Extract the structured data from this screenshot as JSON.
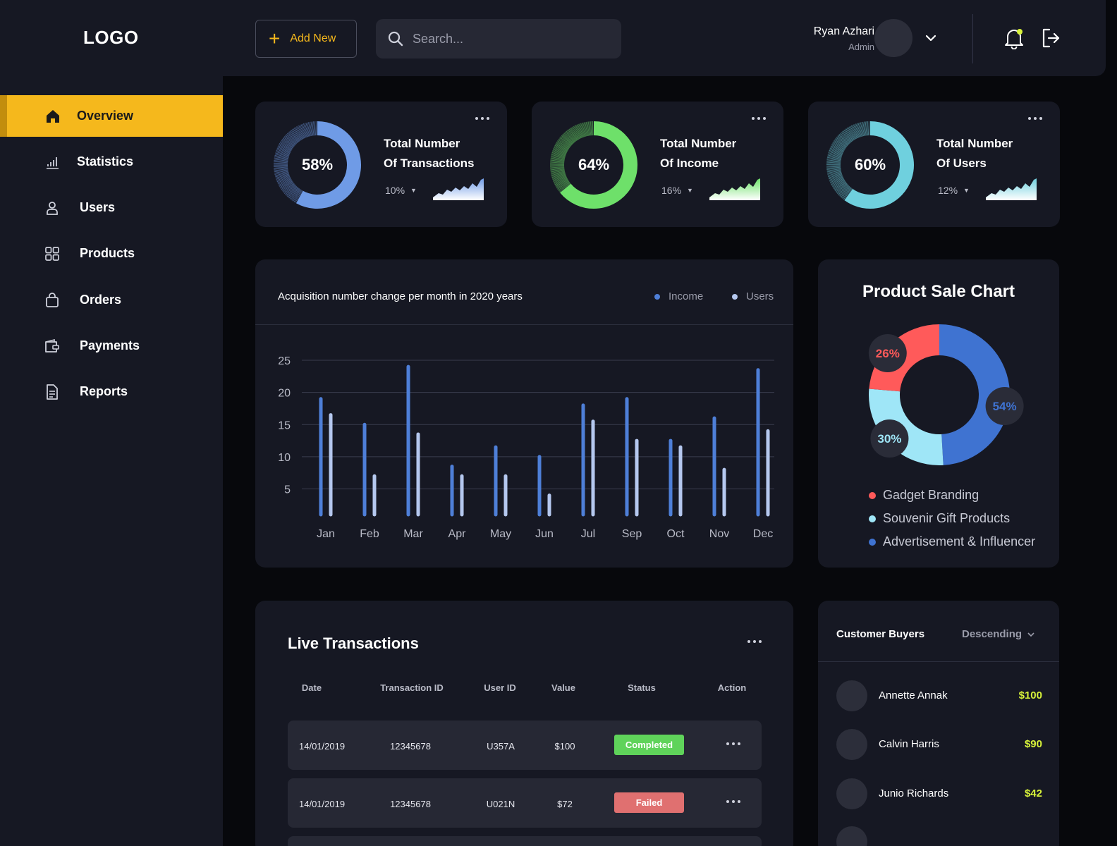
{
  "header": {
    "logo": "LOGO",
    "add_new_label": "Add New",
    "search_placeholder": "Search...",
    "user": {
      "name": "Ryan Azhari",
      "role": "Admin"
    }
  },
  "sidebar": {
    "items": [
      {
        "label": "Overview",
        "icon": "home-icon",
        "active": true
      },
      {
        "label": "Statistics",
        "icon": "bar-chart-icon"
      },
      {
        "label": "Users",
        "icon": "user-icon"
      },
      {
        "label": "Products",
        "icon": "grid-icon"
      },
      {
        "label": "Orders",
        "icon": "shopping-bag-icon"
      },
      {
        "label": "Payments",
        "icon": "wallet-icon"
      },
      {
        "label": "Reports",
        "icon": "document-icon"
      }
    ]
  },
  "stats": [
    {
      "percent": "58%",
      "value": 58,
      "title_line1": "Total Number",
      "title_line2": "Of Transactions",
      "change": "10%",
      "color": "#6f9be6"
    },
    {
      "percent": "64%",
      "value": 64,
      "title_line1": "Total Number",
      "title_line2": "Of Income",
      "change": "16%",
      "color": "#6ee06a"
    },
    {
      "percent": "60%",
      "value": 60,
      "title_line1": "Total Number",
      "title_line2": "Of Users",
      "change": "12%",
      "color": "#6fd0de"
    }
  ],
  "bar_chart": {
    "title": "Acquisition number change per month in 2020 years",
    "legend": [
      {
        "name": "Income",
        "color": "#4e7fd8"
      },
      {
        "name": "Users",
        "color": "#b5c8ef"
      }
    ]
  },
  "pie_chart": {
    "title": "Product Sale Chart",
    "legend": [
      {
        "name": "Gadget Branding",
        "color": "#ff5a5a"
      },
      {
        "name": "Souvenir Gift Products",
        "color": "#9fe6f7"
      },
      {
        "name": "Advertisement & Influencer",
        "color": "#3f73d1"
      }
    ]
  },
  "chart_data": [
    {
      "type": "bar",
      "title": "Acquisition number change per month in 2020 years",
      "categories": [
        "Jan",
        "Feb",
        "Mar",
        "Apr",
        "May",
        "Jun",
        "Jul",
        "Sep",
        "Oct",
        "Nov",
        "Dec"
      ],
      "series": [
        {
          "name": "Income",
          "values": [
            19,
            15,
            24,
            8.5,
            11.5,
            10,
            18,
            19,
            12.5,
            16,
            23.5
          ]
        },
        {
          "name": "Users",
          "values": [
            16.5,
            7,
            13.5,
            7,
            7,
            4,
            15.5,
            12.5,
            11.5,
            8,
            14
          ]
        }
      ],
      "yticks": [
        5,
        10,
        15,
        20,
        25
      ],
      "ylim": [
        1,
        25
      ],
      "grid": true,
      "legend": "top-right"
    },
    {
      "type": "pie",
      "title": "Product Sale Chart",
      "labels": [
        "Advertisement & Influencer",
        "Souvenir Gift Products",
        "Gadget Branding"
      ],
      "values": [
        54,
        30,
        26
      ],
      "value_labels": [
        "54%",
        "30%",
        "26%"
      ],
      "legend": "bottom"
    }
  ],
  "transactions": {
    "title": "Live Transactions",
    "columns": [
      "Date",
      "Transaction ID",
      "User ID",
      "Value",
      "Status",
      "Action"
    ],
    "rows": [
      {
        "date": "14/01/2019",
        "txid": "12345678",
        "user": "U357A",
        "value": "$100",
        "status": "Completed",
        "status_color": "#5fd35a"
      },
      {
        "date": "14/01/2019",
        "txid": "12345678",
        "user": "U021N",
        "value": "$72",
        "status": "Failed",
        "status_color": "#e07070"
      }
    ]
  },
  "buyers": {
    "title": "Customer Buyers",
    "sort": "Descending",
    "items": [
      {
        "name": "Annette Annak",
        "amount": "$100"
      },
      {
        "name": "Calvin Harris",
        "amount": "$90"
      },
      {
        "name": "Junio Richards",
        "amount": "$42"
      }
    ]
  }
}
